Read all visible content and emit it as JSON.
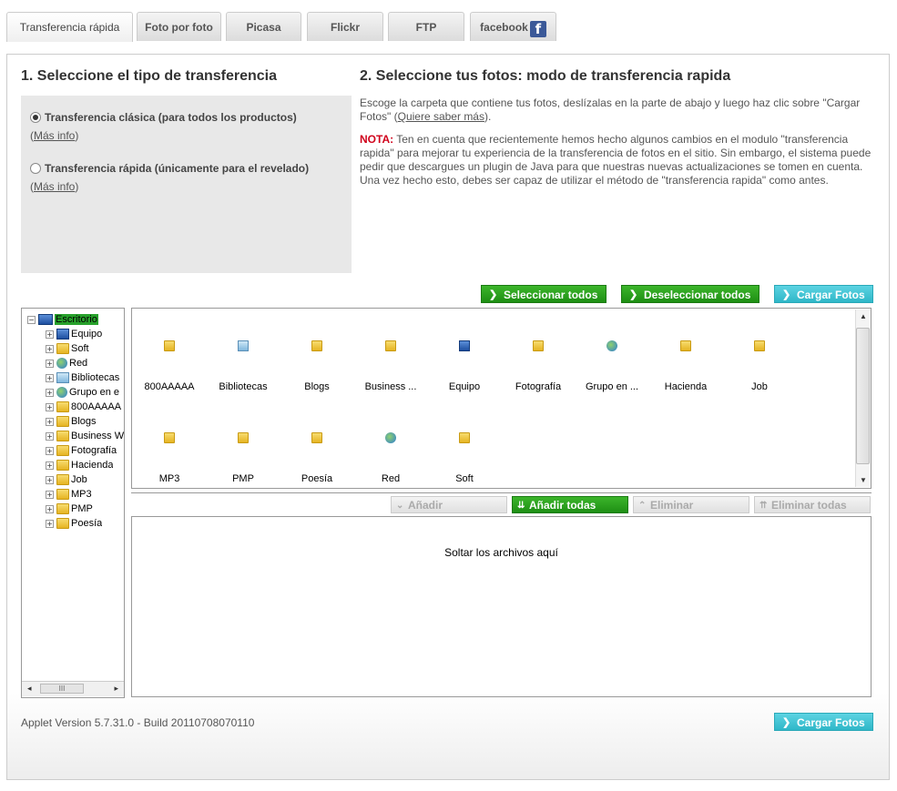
{
  "tabs": [
    {
      "label": "Transferencia rápida",
      "active": true
    },
    {
      "label": "Foto por foto"
    },
    {
      "label": "Picasa"
    },
    {
      "label": "Flickr"
    },
    {
      "label": "FTP"
    },
    {
      "label": "facebook"
    }
  ],
  "section1": {
    "title": "1. Seleccione el tipo de transferencia",
    "options": [
      {
        "label": "Transferencia clásica (para todos los productos)",
        "checked": true,
        "more": "Más info"
      },
      {
        "label": "Transferencia rápida (únicamente para el revelado)",
        "checked": false,
        "more": "Más info"
      }
    ]
  },
  "section2": {
    "title": "2. Seleccione tus fotos: modo de transferencia rapida",
    "desc_pre": "Escoge la carpeta que contiene tus fotos, deslízalas en la parte de abajo y luego haz clic sobre \"Cargar Fotos\" (",
    "desc_link": "Quiere saber más",
    "desc_post": ").",
    "note_label": "NOTA:",
    "note_text": " Ten en cuenta que recientemente hemos hecho algunos cambios en el modulo \"transferencia rapida\" para mejorar tu experiencia de la transferencia de fotos en el sitio. Sin embargo, el sistema puede pedir que descargues un plugin de Java para que nuestras nuevas actualizaciones se tomen en cuenta. Una vez hecho esto, debes ser capaz de utilizar el método de \"transferencia rapida\" como antes."
  },
  "actions": {
    "select_all": "Seleccionar todos",
    "deselect_all": "Deseleccionar todos",
    "upload": "Cargar Fotos"
  },
  "tree": {
    "root": "Escritorio",
    "items": [
      {
        "label": "Equipo",
        "icon": "computer-icon"
      },
      {
        "label": "Soft",
        "icon": "folder-icon"
      },
      {
        "label": "Red",
        "icon": "network-icon"
      },
      {
        "label": "Bibliotecas",
        "icon": "library-icon"
      },
      {
        "label": "Grupo en e",
        "icon": "homegroup-icon"
      },
      {
        "label": "800AAAAA",
        "icon": "folder-icon"
      },
      {
        "label": "Blogs",
        "icon": "folder-icon"
      },
      {
        "label": "Business W",
        "icon": "folder-icon"
      },
      {
        "label": "Fotografía",
        "icon": "folder-icon"
      },
      {
        "label": "Hacienda",
        "icon": "folder-icon"
      },
      {
        "label": "Job",
        "icon": "folder-icon"
      },
      {
        "label": "MP3",
        "icon": "folder-icon"
      },
      {
        "label": "PMP",
        "icon": "folder-icon"
      },
      {
        "label": "Poesía",
        "icon": "folder-icon"
      }
    ]
  },
  "files": [
    {
      "label": "800AAAAA",
      "icon": "folder-icon"
    },
    {
      "label": "Bibliotecas",
      "icon": "library-icon"
    },
    {
      "label": "Blogs",
      "icon": "folder-icon"
    },
    {
      "label": "Business ...",
      "icon": "folder-icon"
    },
    {
      "label": "Equipo",
      "icon": "computer-icon"
    },
    {
      "label": "Fotografía",
      "icon": "folder-icon"
    },
    {
      "label": "Grupo en ...",
      "icon": "homegroup-icon"
    },
    {
      "label": "Hacienda",
      "icon": "folder-icon"
    },
    {
      "label": "Job",
      "icon": "folder-icon"
    },
    {
      "label": "MP3",
      "icon": "folder-icon"
    },
    {
      "label": "PMP",
      "icon": "folder-icon"
    },
    {
      "label": "Poesía",
      "icon": "folder-icon"
    },
    {
      "label": "Red",
      "icon": "network-icon"
    },
    {
      "label": "Soft",
      "icon": "folder-icon"
    }
  ],
  "toolbar": {
    "add": "Añadir",
    "add_all": "Añadir todas",
    "remove": "Eliminar",
    "remove_all": "Eliminar todas"
  },
  "dropzone": {
    "text": "Soltar los archivos aquí"
  },
  "footer": {
    "version": "Applet Version 5.7.31.0 - Build 20110708070110",
    "upload": "Cargar Fotos"
  }
}
